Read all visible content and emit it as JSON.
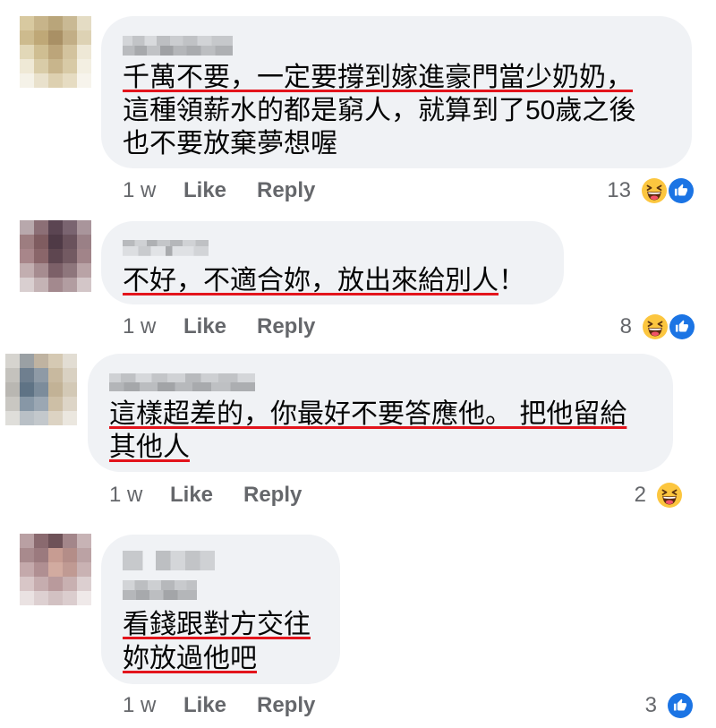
{
  "colors": {
    "bubble_bg": "#f0f2f5",
    "text": "#050505",
    "meta_text": "#65676b",
    "annotation_red": "#e3141c",
    "like_blue": "#1b74e4",
    "haha_yellow": "#fcc63f"
  },
  "comments": [
    {
      "avatar_pixels": [
        [
          "#d8c9a0",
          "#c7b48a",
          "#b9a57a",
          "#c9b994",
          "#e4dcc4"
        ],
        [
          "#cdbb8e",
          "#bfa877",
          "#a99065",
          "#c2ae86",
          "#ddd2b4"
        ],
        [
          "#e2d8b8",
          "#cfbe92",
          "#bca57a",
          "#d3c39e",
          "#eee8d6"
        ],
        [
          "#efe9d6",
          "#d9cca8",
          "#c8b58c",
          "#d8caa6",
          "#f3efe2"
        ],
        [
          "#f5f2e8",
          "#e9e1cc",
          "#ddd0b0",
          "#e6dcc2",
          "#f7f4ec"
        ]
      ],
      "lines": [
        {
          "underlined": "千萬不要，一定要撐到嫁進豪門當少奶奶，"
        },
        {
          "plain": "這種領薪水的都是窮人，就算到了50歲之後"
        },
        {
          "plain": "也不要放棄夢想喔"
        }
      ],
      "time": "1 w",
      "like_label": "Like",
      "reply_label": "Reply",
      "reaction_count": "13",
      "reaction_icons": [
        "haha-icon",
        "like-icon"
      ]
    },
    {
      "avatar_pixels": [
        [
          "#b8a8ac",
          "#8c6f76",
          "#5b4552",
          "#7a6470",
          "#a9959b"
        ],
        [
          "#9d7d80",
          "#7f5c60",
          "#4f3a46",
          "#6a525c",
          "#9a8086"
        ],
        [
          "#a8868a",
          "#8a666a",
          "#5e4650",
          "#735a62",
          "#a18489"
        ],
        [
          "#c2aeb0",
          "#a68c90",
          "#7c6068",
          "#8e767c",
          "#b9a3a6"
        ],
        [
          "#d9cfd0",
          "#c4b3b5",
          "#a3898e",
          "#b29da1",
          "#d3c6c8"
        ]
      ],
      "lines": [
        {
          "underlined": "不好，不適合妳，放出來給別人",
          "plain": "！"
        }
      ],
      "time": "1 w",
      "like_label": "Like",
      "reply_label": "Reply",
      "reaction_count": "8",
      "reaction_icons": [
        "haha-icon",
        "like-icon"
      ]
    },
    {
      "avatar_pixels": [
        [
          "#d6d4cf",
          "#9aa0a4",
          "#bfb3a1",
          "#d5c9b3",
          "#e2ddd3"
        ],
        [
          "#c4c2bd",
          "#6f7f8f",
          "#8e9aa6",
          "#c8b99f",
          "#d9d1c2"
        ],
        [
          "#b9b7b2",
          "#5f7385",
          "#7c8c9b",
          "#c2b296",
          "#d3c9b6"
        ],
        [
          "#c9c7c2",
          "#8797a6",
          "#9ba7b3",
          "#cdbfa6",
          "#ddd5c7"
        ],
        [
          "#dfdeda",
          "#b9c0c6",
          "#c3c8cc",
          "#dcd3c3",
          "#ebe7df"
        ]
      ],
      "lines": [
        {
          "underlined": "這樣超差的，你最好不要答應他。 把他留給"
        },
        {
          "underlined": "其他人"
        }
      ],
      "time": "1 w",
      "like_label": "Like",
      "reply_label": "Reply",
      "reaction_count": "2",
      "reaction_icons": [
        "haha-icon"
      ]
    },
    {
      "avatar_pixels": [
        [
          "#b9a0a3",
          "#8a6a6f",
          "#6e5258",
          "#a3868a",
          "#c7b3b5"
        ],
        [
          "#a88a8d",
          "#9b7a7e",
          "#c79c92",
          "#b48d88",
          "#bba2a4"
        ],
        [
          "#c4a9ab",
          "#b08f92",
          "#d2aba0",
          "#c09a93",
          "#c9b2b3"
        ],
        [
          "#d8c6c7",
          "#c6adaf",
          "#b99a9c",
          "#c8b0b1",
          "#dccfd0"
        ],
        [
          "#eae2e2",
          "#ddd0d1",
          "#d2c1c2",
          "#dbcdce",
          "#efe9e9"
        ]
      ],
      "lines": [
        {
          "underlined": "看錢跟對方交往"
        },
        {
          "underlined": "妳放過他吧"
        }
      ],
      "time": "1 w",
      "like_label": "Like",
      "reply_label": "Reply",
      "reaction_count": "3",
      "reaction_icons": [
        "like-icon"
      ]
    }
  ]
}
